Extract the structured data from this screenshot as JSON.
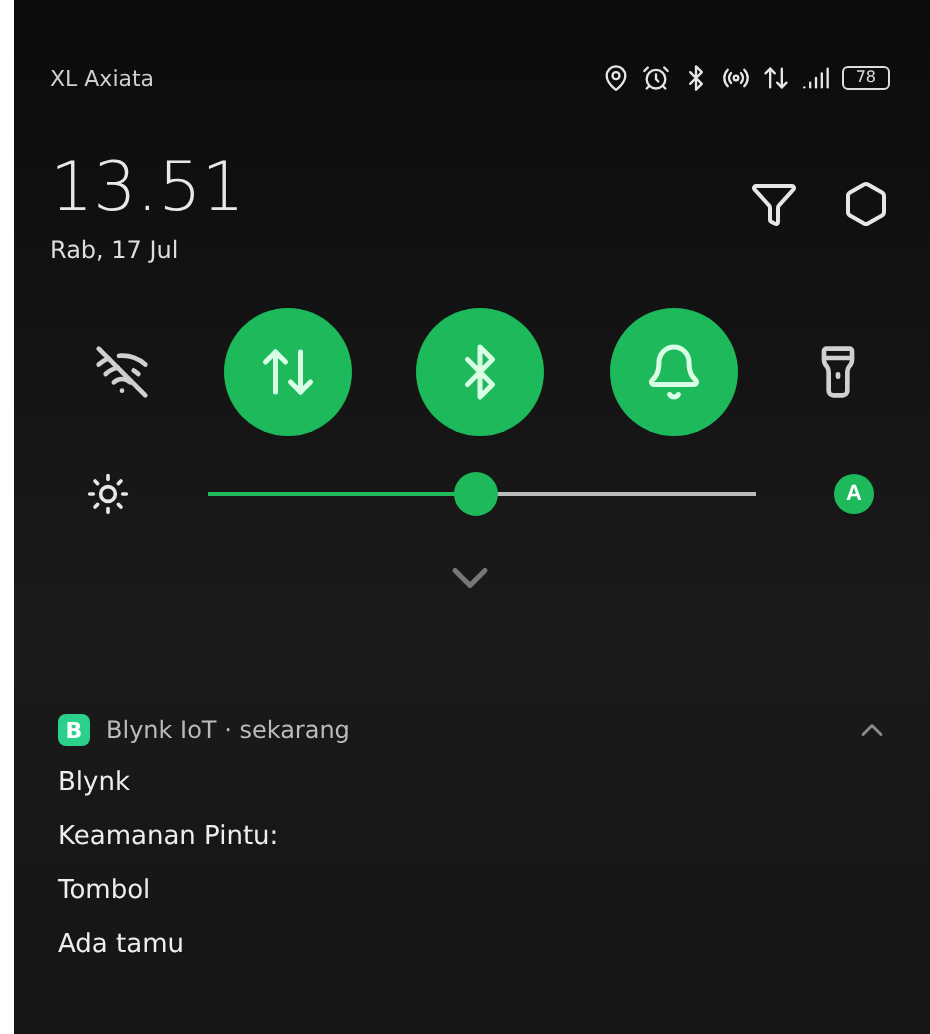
{
  "status_bar": {
    "carrier": "XL Axiata",
    "battery": "78"
  },
  "header": {
    "time": "13.51",
    "date": "Rab, 17 Jul"
  },
  "toggles": [
    {
      "kind": "wifi",
      "on": false
    },
    {
      "kind": "data",
      "on": true
    },
    {
      "kind": "bluetooth",
      "on": true
    },
    {
      "kind": "sound",
      "on": true
    },
    {
      "kind": "flashlight",
      "on": false
    }
  ],
  "brightness": {
    "level": 0.49,
    "auto": "A"
  },
  "notification": {
    "app_icon": "B",
    "source": "Blynk IoT · sekarang",
    "expanded": true,
    "lines": [
      "Blynk",
      "Keamanan Pintu:",
      "Tombol",
      "Ada tamu"
    ]
  }
}
